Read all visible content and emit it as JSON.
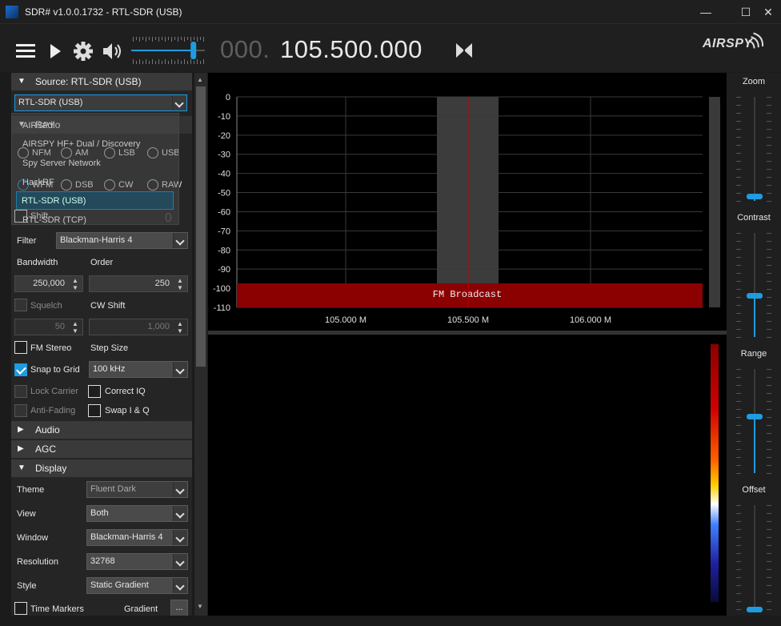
{
  "window": {
    "title": "SDR# v1.0.0.1732 - RTL-SDR (USB)",
    "minimize": "—",
    "maximize": "☐",
    "close": "✕"
  },
  "toolbar": {
    "menu_icon": "hamburger-menu-icon",
    "play_icon": "play-icon",
    "settings_icon": "gear-icon",
    "volume_icon": "speaker-icon",
    "volume_level": 0.85,
    "frequency_dim": "000.",
    "frequency_main": "105.500.000",
    "tune_icon": "bowtie-swap-icon",
    "brand": "AIRSPY"
  },
  "source": {
    "header": "Source: RTL-SDR (USB)",
    "selected": "RTL-SDR (USB)",
    "options": [
      "AIRSPY",
      "AIRSPY HF+ Dual / Discovery",
      "Spy Server Network",
      "HackRF",
      "RTL-SDR (USB)",
      "RTL-SDR (TCP)"
    ]
  },
  "radio": {
    "header": "Radio",
    "modes": [
      "NFM",
      "AM",
      "LSB",
      "USB",
      "WFM",
      "DSB",
      "CW",
      "RAW"
    ],
    "shift_label": "Shift",
    "shift_value": "0"
  },
  "filter": {
    "label": "Filter",
    "value": "Blackman-Harris 4"
  },
  "bandwidth": {
    "label": "Bandwidth",
    "value": "250,000"
  },
  "order": {
    "label": "Order",
    "value": "250"
  },
  "squelch": {
    "label": "Squelch",
    "value": "50"
  },
  "cw_shift": {
    "label": "CW Shift",
    "value": "1,000"
  },
  "fm_stereo": {
    "label": "FM Stereo"
  },
  "step_size": {
    "label": "Step Size",
    "value": "100 kHz"
  },
  "snap_to_grid": {
    "label": "Snap to Grid",
    "checked": true
  },
  "lock_carrier": {
    "label": "Lock Carrier"
  },
  "correct_iq": {
    "label": "Correct IQ"
  },
  "anti_fading": {
    "label": "Anti-Fading"
  },
  "swap_iq": {
    "label": "Swap I & Q"
  },
  "sections": {
    "audio": "Audio",
    "agc": "AGC",
    "display": "Display"
  },
  "display": {
    "theme_label": "Theme",
    "theme": "Fluent Dark",
    "view_label": "View",
    "view": "Both",
    "window_label": "Window",
    "window": "Blackman-Harris 4",
    "resolution_label": "Resolution",
    "resolution": "32768",
    "style_label": "Style",
    "style": "Static Gradient",
    "time_markers": "Time Markers",
    "gradient_label": "Gradient",
    "gradient_button": "..."
  },
  "spectrum": {
    "y_ticks": [
      "0",
      "-10",
      "-20",
      "-30",
      "-40",
      "-50",
      "-60",
      "-70",
      "-80",
      "-90",
      "-100",
      "-110"
    ],
    "x_ticks": [
      "105.000 M",
      "105.500 M",
      "106.000 M"
    ],
    "band_label": "FM Broadcast",
    "colors": {
      "band": "#8b0000",
      "filter": "#3c3c3c",
      "center_line": "#c00000",
      "grid": "#3a3a3a"
    }
  },
  "right_panel": {
    "zoom": "Zoom",
    "zoom_level": 0.05,
    "contrast": "Contrast",
    "contrast_level": 0.4,
    "range": "Range",
    "range_level": 0.55,
    "offset": "Offset",
    "offset_level": 0.0
  }
}
